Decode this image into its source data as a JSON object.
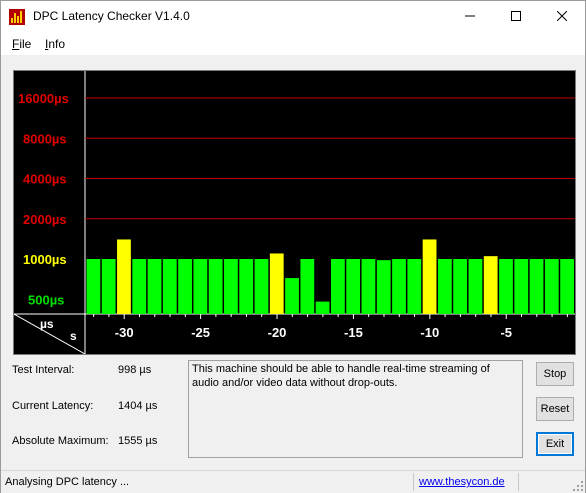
{
  "window": {
    "title": "DPC Latency Checker V1.4.0",
    "controls": {
      "minimize": "minimize",
      "maximize": "maximize",
      "close": "close"
    }
  },
  "menu": {
    "file_accel": "F",
    "file_rest": "ile",
    "info_accel": "I",
    "info_rest": "nfo"
  },
  "chart_data": {
    "type": "bar",
    "y_scale": "log",
    "y_tick_labels": [
      "16000µs",
      "8000µs",
      "4000µs",
      "2000µs",
      "1000µs",
      "500µs"
    ],
    "y_tick_values": [
      16000,
      8000,
      4000,
      2000,
      1000,
      500
    ],
    "x_tick_labels": [
      "-30",
      "-25",
      "-20",
      "-15",
      "-10",
      "-5"
    ],
    "x_tick_values": [
      -30,
      -25,
      -20,
      -15,
      -10,
      -5
    ],
    "unit_top": "µs",
    "unit_bottom": "s",
    "x": [
      -32,
      -31,
      -30,
      -29,
      -28,
      -27,
      -26,
      -25,
      -24,
      -23,
      -22,
      -21,
      -20,
      -19,
      -18,
      -17,
      -16,
      -15,
      -14,
      -13,
      -12,
      -11,
      -10,
      -9,
      -8,
      -7,
      -6,
      -5,
      -4,
      -3,
      -2,
      -1
    ],
    "values": [
      1000,
      1000,
      1400,
      1000,
      1000,
      1000,
      1000,
      1000,
      1000,
      1000,
      1000,
      1000,
      1100,
      720,
      1000,
      480,
      1000,
      1000,
      1000,
      980,
      1000,
      1000,
      1400,
      1000,
      1000,
      1000,
      1050,
      1000,
      1000,
      1000,
      1000,
      1000
    ],
    "colors": {
      "normal": "#00ff00",
      "warning": "#ffff00",
      "background": "#000000",
      "grid": "#c00000",
      "tick_label_high": "#e00000",
      "tick_label_1000": "#ffff00",
      "tick_label_500": "#00e000"
    },
    "warning_threshold": 1024,
    "grid": true
  },
  "stats": {
    "test_interval_label": "Test Interval:",
    "test_interval_value": "998 µs",
    "current_latency_label": "Current Latency:",
    "current_latency_value": "1404 µs",
    "absolute_maximum_label": "Absolute Maximum:",
    "absolute_maximum_value": "1555 µs"
  },
  "message": "This machine should be able to handle real-time streaming of audio and/or video data without drop-outs.",
  "buttons": {
    "stop": "Stop",
    "reset": "Reset",
    "exit": "Exit"
  },
  "status": {
    "text": "Analysing DPC latency ...",
    "link": "www.thesycon.de"
  }
}
